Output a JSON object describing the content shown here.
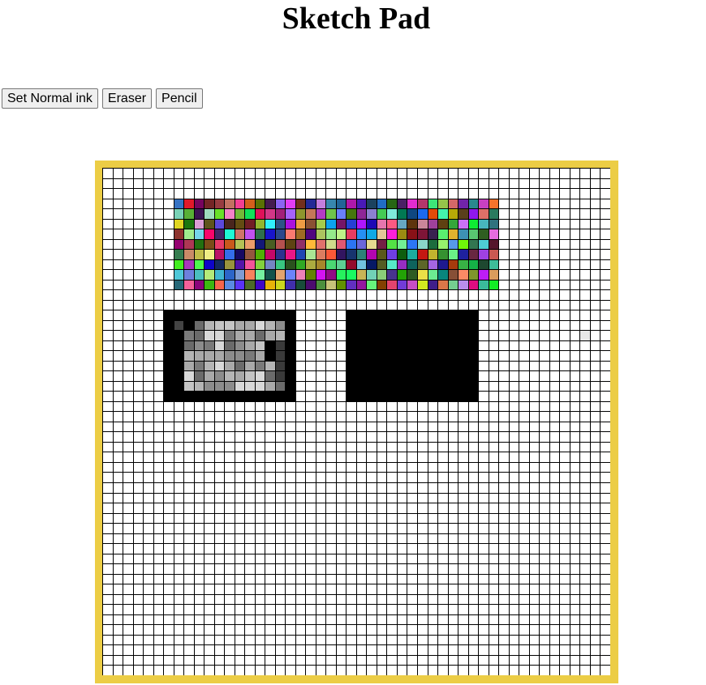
{
  "app": {
    "title": "Sketch Pad"
  },
  "toolbar": {
    "normal_ink_label": "Set Normal ink",
    "eraser_label": "Eraser",
    "pencil_label": "Pencil"
  },
  "canvas": {
    "frame_color": "#eccd45",
    "grid_color": "#000000",
    "background_color": "#ffffff",
    "columns": 50,
    "rows": 50
  }
}
